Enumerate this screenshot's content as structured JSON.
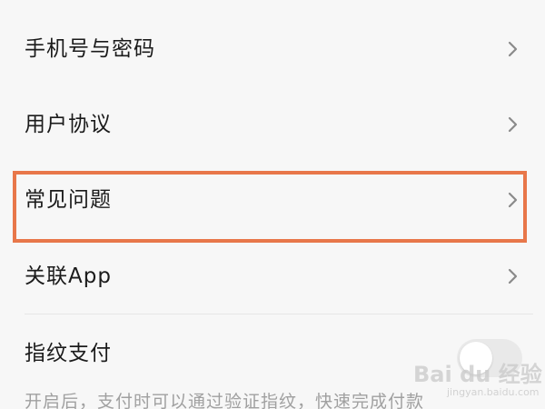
{
  "menu": {
    "items": [
      {
        "label": "手机号与密码",
        "icon": "chevron-right-icon"
      },
      {
        "label": "用户协议",
        "icon": "chevron-right-icon"
      },
      {
        "label": "常见问题",
        "icon": "chevron-right-icon",
        "highlighted": true
      },
      {
        "label": "关联App",
        "icon": "chevron-right-icon"
      }
    ]
  },
  "fingerprint_pay": {
    "title": "指纹支付",
    "description": "开启后，支付时可以通过验证指纹，快速完成付款",
    "enabled": false
  },
  "watermark": {
    "brand": "Bai du 经验",
    "url": "jingyan.baidu.com"
  },
  "colors": {
    "highlight_border": "#e8774a",
    "background": "#f7f7f7",
    "chevron": "#8a8a8a"
  }
}
